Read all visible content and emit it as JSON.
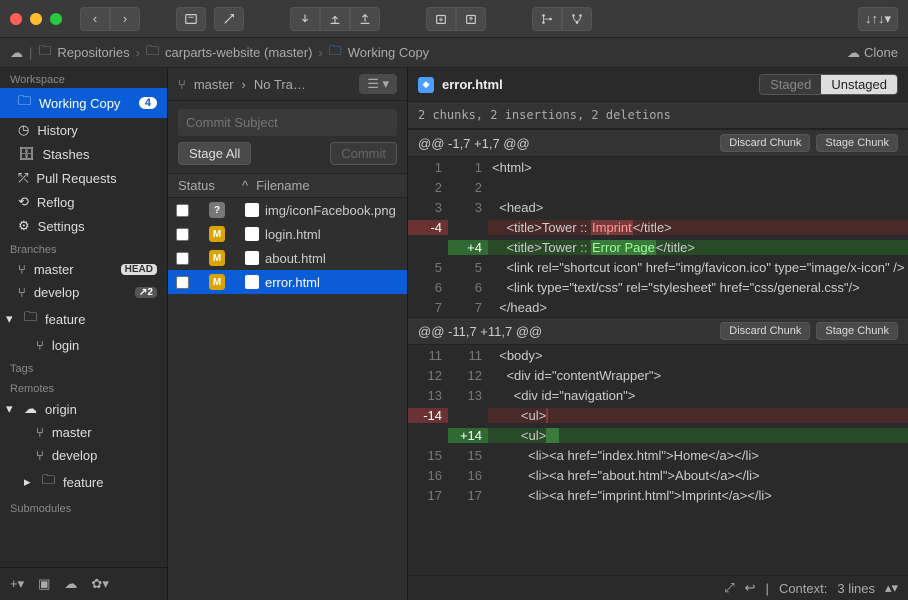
{
  "breadcrumbs": {
    "root": "Repositories",
    "repo": "carparts-website (master)",
    "leaf": "Working Copy",
    "clone": "Clone"
  },
  "sidebar": {
    "workspace_header": "Workspace",
    "workspace": [
      {
        "label": "Working Copy",
        "badge": "4",
        "active": true
      },
      {
        "label": "History"
      },
      {
        "label": "Stashes"
      },
      {
        "label": "Pull Requests"
      },
      {
        "label": "Reflog"
      },
      {
        "label": "Settings"
      }
    ],
    "branches_header": "Branches",
    "branches": [
      {
        "label": "master",
        "head": "HEAD"
      },
      {
        "label": "develop",
        "count": "↗2"
      },
      {
        "label": "feature",
        "expandable": true
      },
      {
        "label": "login",
        "nested": true
      }
    ],
    "tags_header": "Tags",
    "remotes_header": "Remotes",
    "remotes": [
      {
        "label": "origin",
        "expandable": true
      },
      {
        "label": "master",
        "nested": true
      },
      {
        "label": "develop",
        "nested": true
      },
      {
        "label": "feature",
        "nested": true,
        "expandable": true
      }
    ],
    "submodules_header": "Submodules"
  },
  "mid": {
    "branch": "master",
    "tracking": "No Tra…",
    "commit_placeholder": "Commit Subject",
    "stage_all": "Stage All",
    "commit_btn": "Commit",
    "col_status": "Status",
    "col_filename": "Filename",
    "files": [
      {
        "status": "?",
        "status_class": "status-q",
        "name": "img/iconFacebook.png"
      },
      {
        "status": "M",
        "status_class": "status-m",
        "name": "login.html"
      },
      {
        "status": "M",
        "status_class": "status-m",
        "name": "about.html"
      },
      {
        "status": "M",
        "status_class": "status-m",
        "name": "error.html",
        "selected": true
      }
    ]
  },
  "diff": {
    "filename": "error.html",
    "seg_staged": "Staged",
    "seg_unstaged": "Unstaged",
    "summary": "2 chunks, 2 insertions, 2 deletions",
    "discard": "Discard Chunk",
    "stage": "Stage Chunk",
    "hunks": [
      {
        "header": "@@ -1,7 +1,7 @@",
        "rows": [
          {
            "l1": "1",
            "l2": "1",
            "t": "ctx",
            "code": "<html>"
          },
          {
            "l1": "2",
            "l2": "2",
            "t": "ctx",
            "code": ""
          },
          {
            "l1": "3",
            "l2": "3",
            "t": "ctx",
            "code": "  <head>"
          },
          {
            "l1": "-4",
            "l2": "",
            "t": "del",
            "pre": "    <title>Tower :: ",
            "hl": "Imprint",
            "post": "</title>"
          },
          {
            "l1": "",
            "l2": "+4",
            "t": "add",
            "pre": "    <title>Tower :: ",
            "hl": "Error Page",
            "post": "</title>"
          },
          {
            "l1": "5",
            "l2": "5",
            "t": "ctx",
            "code": "    <link rel=\"shortcut icon\" href=\"img/favicon.ico\" type=\"image/x-icon\" />"
          },
          {
            "l1": "6",
            "l2": "6",
            "t": "ctx",
            "code": "    <link type=\"text/css\" rel=\"stylesheet\" href=\"css/general.css\"/>"
          },
          {
            "l1": "7",
            "l2": "7",
            "t": "ctx",
            "code": "  </head>"
          }
        ]
      },
      {
        "header": "@@ -11,7 +11,7 @@",
        "rows": [
          {
            "l1": "11",
            "l2": "11",
            "t": "ctx",
            "code": "  <body>"
          },
          {
            "l1": "12",
            "l2": "12",
            "t": "ctx",
            "code": "    <div id=\"contentWrapper\">"
          },
          {
            "l1": "13",
            "l2": "13",
            "t": "ctx",
            "code": "      <div id=\"navigation\">"
          },
          {
            "l1": "-14",
            "l2": "",
            "t": "del",
            "pre": "        <ul>",
            "hl": "",
            "post": ""
          },
          {
            "l1": "",
            "l2": "+14",
            "t": "add",
            "pre": "        <ul>",
            "hl": "   ",
            "post": ""
          },
          {
            "l1": "15",
            "l2": "15",
            "t": "ctx",
            "code": "          <li><a href=\"index.html\">Home</a></li>"
          },
          {
            "l1": "16",
            "l2": "16",
            "t": "ctx",
            "code": "          <li><a href=\"about.html\">About</a></li>"
          },
          {
            "l1": "17",
            "l2": "17",
            "t": "ctx",
            "code": "          <li><a href=\"imprint.html\">Imprint</a></li>"
          }
        ]
      }
    ],
    "context_label": "Context:",
    "context_value": "3 lines"
  }
}
